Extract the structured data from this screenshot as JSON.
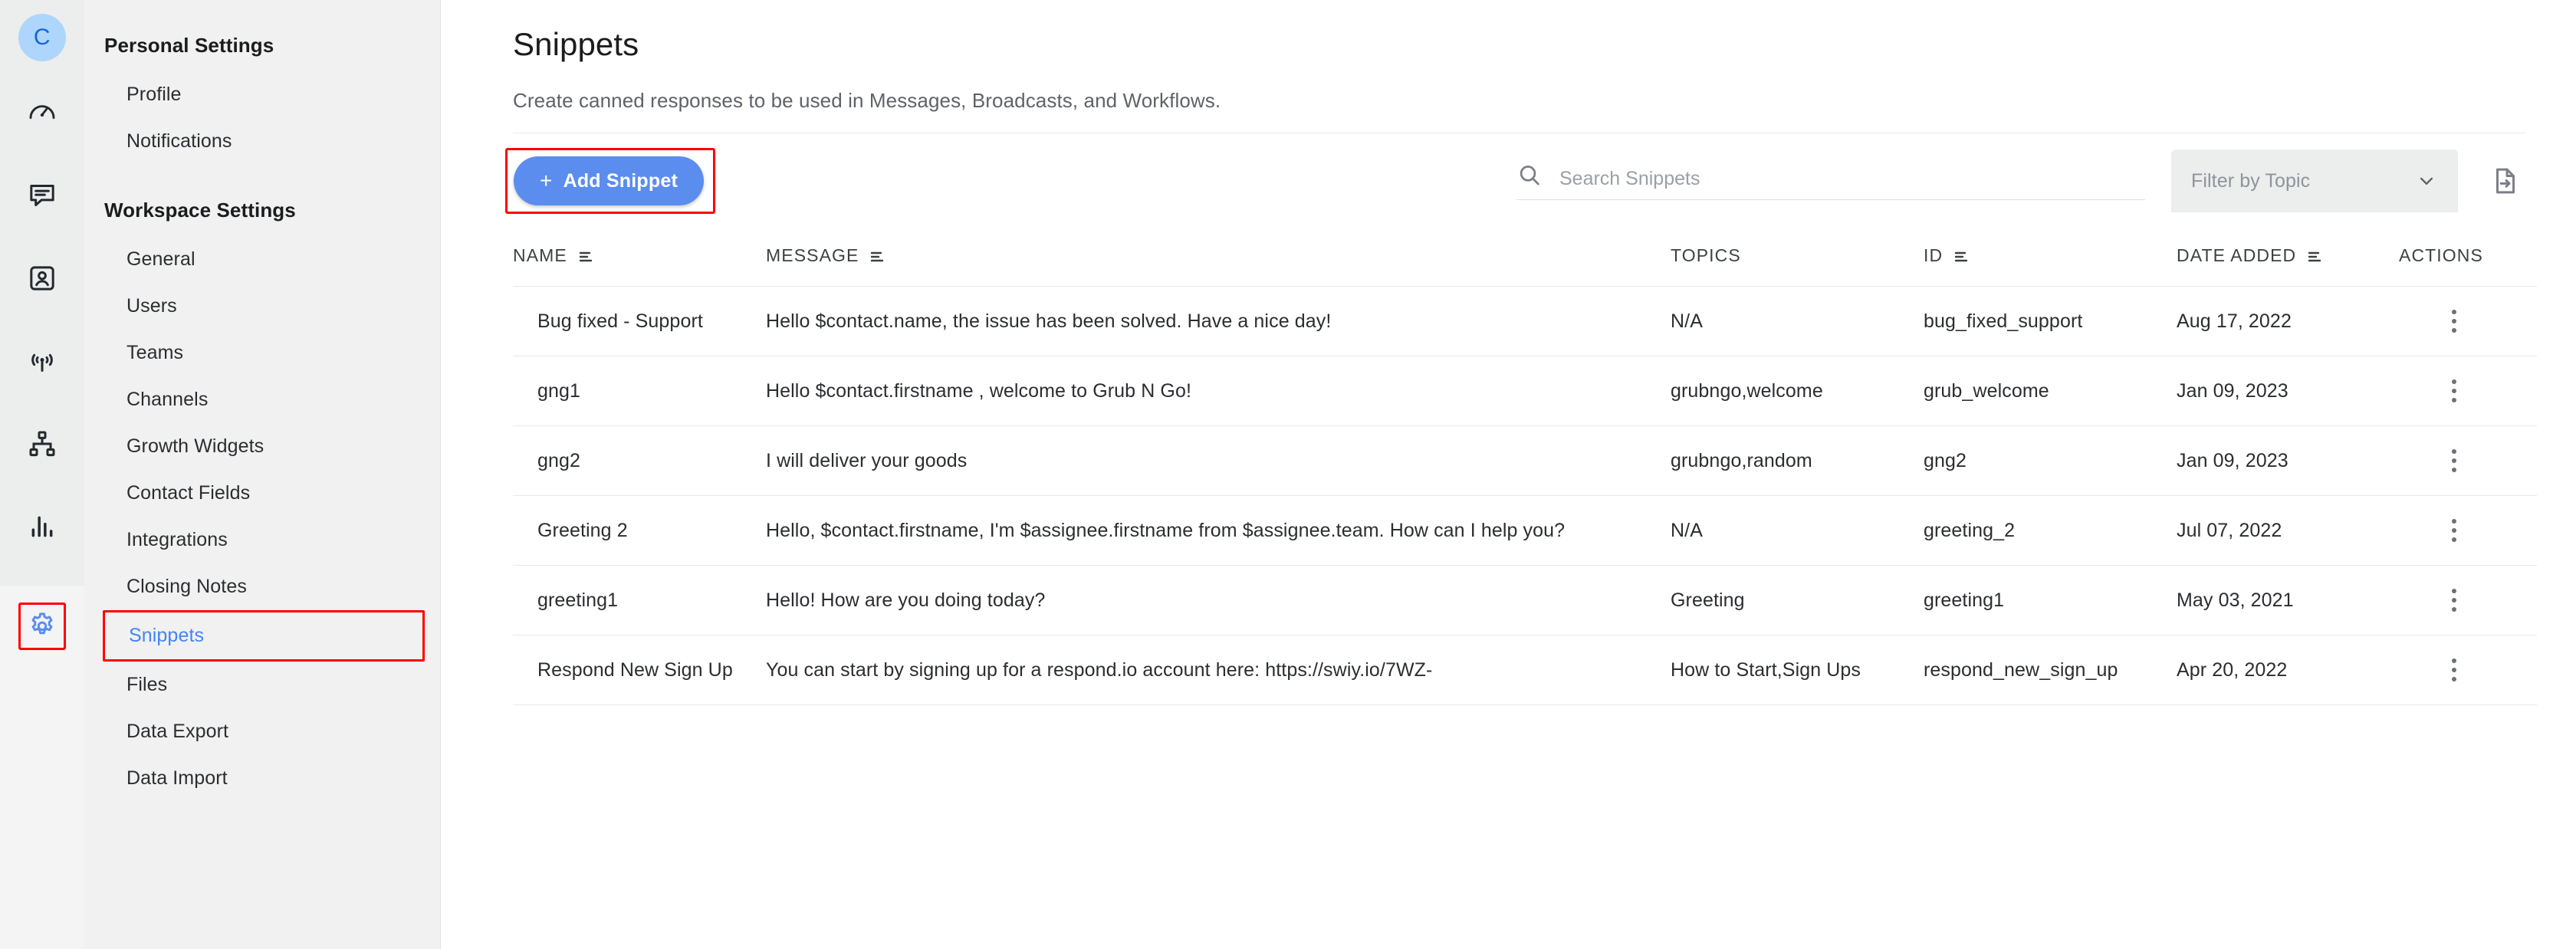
{
  "rail": {
    "avatar_initial": "C",
    "icons": [
      {
        "name": "dashboard-icon",
        "label": "Dashboard"
      },
      {
        "name": "messages-icon",
        "label": "Messages"
      },
      {
        "name": "contacts-icon",
        "label": "Contacts"
      },
      {
        "name": "broadcasts-icon",
        "label": "Broadcasts"
      },
      {
        "name": "workflows-icon",
        "label": "Workflows"
      },
      {
        "name": "reports-icon",
        "label": "Reports"
      }
    ],
    "settings_icon": "gear-icon",
    "settings_active": true,
    "highlight_color": "#ff0000",
    "settings_color": "#5b8def",
    "avatar_bg": "#aed5fb",
    "avatar_fg": "#1565d8"
  },
  "nav": {
    "sections": [
      {
        "title": "Personal Settings",
        "items": [
          {
            "label": "Profile",
            "active": false,
            "boxed": false
          },
          {
            "label": "Notifications",
            "active": false,
            "boxed": false
          }
        ]
      },
      {
        "title": "Workspace Settings",
        "items": [
          {
            "label": "General",
            "active": false,
            "boxed": false
          },
          {
            "label": "Users",
            "active": false,
            "boxed": false
          },
          {
            "label": "Teams",
            "active": false,
            "boxed": false
          },
          {
            "label": "Channels",
            "active": false,
            "boxed": false
          },
          {
            "label": "Growth Widgets",
            "active": false,
            "boxed": false
          },
          {
            "label": "Contact Fields",
            "active": false,
            "boxed": false
          },
          {
            "label": "Integrations",
            "active": false,
            "boxed": false
          },
          {
            "label": "Closing Notes",
            "active": false,
            "boxed": false
          },
          {
            "label": "Snippets",
            "active": true,
            "boxed": true
          },
          {
            "label": "Files",
            "active": false,
            "boxed": false
          },
          {
            "label": "Data Export",
            "active": false,
            "boxed": false
          },
          {
            "label": "Data Import",
            "active": false,
            "boxed": false
          }
        ]
      }
    ]
  },
  "page": {
    "title": "Snippets",
    "subtitle": "Create canned responses to be used in Messages, Broadcasts, and Workflows."
  },
  "toolbar": {
    "add_label": "Add Snippet",
    "add_plus": "+",
    "add_highlighted": true,
    "add_bg": "#5b8def",
    "search_placeholder": "Search Snippets",
    "search_value": "",
    "filter_label": "Filter by Topic",
    "export_icon": "export-document-icon"
  },
  "table": {
    "columns": [
      {
        "label": "NAME",
        "sortable": true
      },
      {
        "label": "MESSAGE",
        "sortable": true
      },
      {
        "label": "TOPICS",
        "sortable": false
      },
      {
        "label": "ID",
        "sortable": true
      },
      {
        "label": "DATE ADDED",
        "sortable": true
      },
      {
        "label": "ACTIONS",
        "sortable": false
      }
    ],
    "rows": [
      {
        "name": "Bug fixed - Support",
        "message": "Hello $contact.name, the issue has been solved. Have a nice day!",
        "topics": "N/A",
        "id": "bug_fixed_support",
        "date": "Aug 17, 2022"
      },
      {
        "name": "gng1",
        "message": "Hello $contact.firstname , welcome to Grub N Go!",
        "topics": "grubngo,welcome",
        "id": "grub_welcome",
        "date": "Jan 09, 2023"
      },
      {
        "name": "gng2",
        "message": "I will deliver your goods",
        "topics": "grubngo,random",
        "id": "gng2",
        "date": "Jan 09, 2023"
      },
      {
        "name": "Greeting 2",
        "message": "Hello, $contact.firstname, I'm $assignee.firstname from $assignee.team. How can I help you?",
        "topics": "N/A",
        "id": "greeting_2",
        "date": "Jul 07, 2022"
      },
      {
        "name": "greeting1",
        "message": "Hello! How are you doing today?",
        "topics": "Greeting",
        "id": "greeting1",
        "date": "May 03, 2021"
      },
      {
        "name": "Respond New Sign Up",
        "message": "You can start by signing up for a respond.io account here: https://swiy.io/7WZ-",
        "topics": "How to Start,Sign Ups",
        "id": "respond_new_sign_up",
        "date": "Apr 20, 2022"
      }
    ]
  }
}
